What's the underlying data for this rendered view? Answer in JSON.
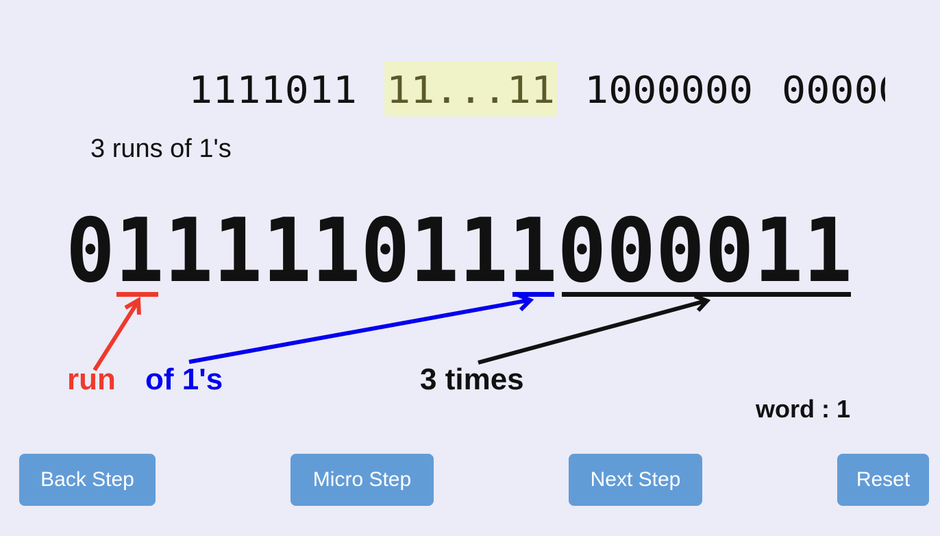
{
  "top_sequence": {
    "segments": [
      "1111011",
      "11...11",
      "1000000",
      "00000"
    ],
    "highlighted_segment": "11...11",
    "highlight_color": "#f0f2c8",
    "highlight_text_color": "#5b5a2a"
  },
  "runs_label": "3 runs of 1's",
  "bit_string": "0111110111000011",
  "annotations": {
    "run": {
      "text": "run",
      "color": "#ee3a2c"
    },
    "of_ones": {
      "text": "of 1's",
      "color": "#0000ee"
    },
    "times": {
      "text": "3 times",
      "color": "#111111"
    }
  },
  "word_counter": "word : 1",
  "buttons": {
    "back": "Back Step",
    "micro": "Micro Step",
    "next": "Next Step",
    "reset": "Reset"
  },
  "colors": {
    "background": "#ecebf8",
    "button": "#629cd7",
    "button_text": "#ffffff"
  }
}
